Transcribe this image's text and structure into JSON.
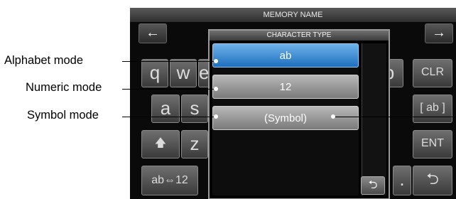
{
  "window": {
    "title": "MEMORY NAME"
  },
  "nav": {
    "left_arrow": "←",
    "right_arrow": "→"
  },
  "keyboard": {
    "q": "q",
    "w": "w",
    "e": "e",
    "p": "p",
    "a": "a",
    "s": "s",
    "z": "z",
    "clr": "CLR",
    "ab_bracket": "[ ab ]",
    "ent": "ENT",
    "shift_icon": "up-arrow-shift",
    "shift": "🡅",
    "mode_switch": "ab⇔12",
    "dot": ".",
    "back_icon": "return-arrow-icon",
    "back": "⮌"
  },
  "dialog": {
    "title": "CHARACTER TYPE",
    "options": [
      {
        "label": "ab",
        "selected": true
      },
      {
        "label": "12",
        "selected": false
      },
      {
        "label": "(Symbol)",
        "selected": false
      }
    ],
    "return_icon": "return-arrow-icon",
    "return_glyph": "⮌"
  },
  "callouts": {
    "alphabet": "Alphabet mode",
    "numeric": "Numeric mode",
    "symbol": "Symbol mode"
  },
  "colors": {
    "selected_blue": "#1d6fbe",
    "screen_bg": "#0a0a0a"
  }
}
